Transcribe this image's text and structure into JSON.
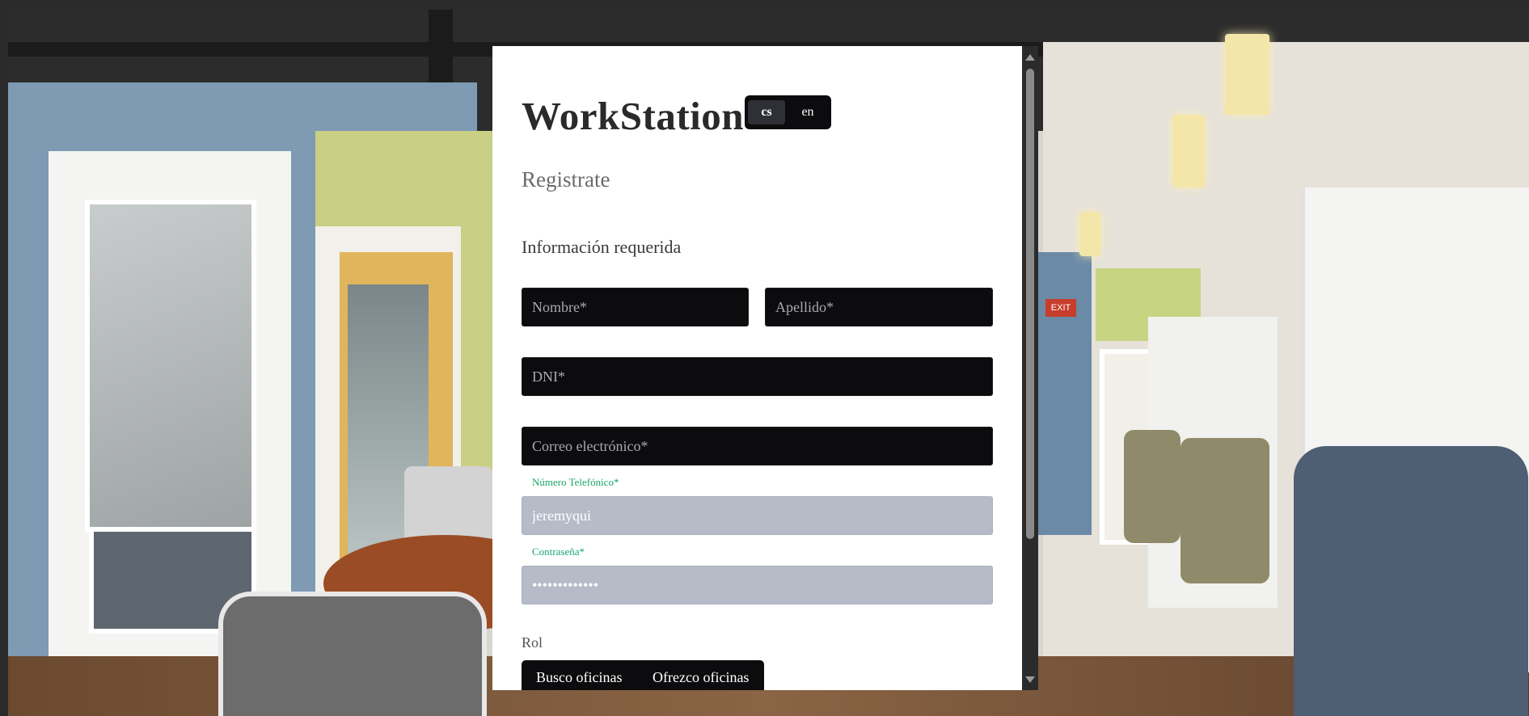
{
  "app": {
    "brand": "WorkStation",
    "subtitle": "Registrate",
    "section_title": "Información requerida"
  },
  "language_switch": {
    "options": [
      "cs",
      "en"
    ],
    "selected": "cs"
  },
  "form": {
    "first_name": {
      "placeholder": "Nombre*",
      "value": ""
    },
    "last_name": {
      "placeholder": "Apellido*",
      "value": ""
    },
    "dni": {
      "placeholder": "DNI*",
      "value": ""
    },
    "email": {
      "placeholder": "Correo electrónico*",
      "value": ""
    },
    "phone": {
      "label": "Número Telefónico*",
      "value": "jeremyqui"
    },
    "password": {
      "label": "Contraseña*",
      "value": "•••••••••••••"
    },
    "role": {
      "label": "Rol",
      "options": [
        "Busco oficinas",
        "Ofrezco oficinas"
      ]
    }
  },
  "background_scene": {
    "exit_sign": "EXIT"
  },
  "colors": {
    "field_dark": "#0c0c0e",
    "field_filled": "#b5bcc8",
    "label_green": "#1aa56b",
    "panel": "#ffffff"
  }
}
